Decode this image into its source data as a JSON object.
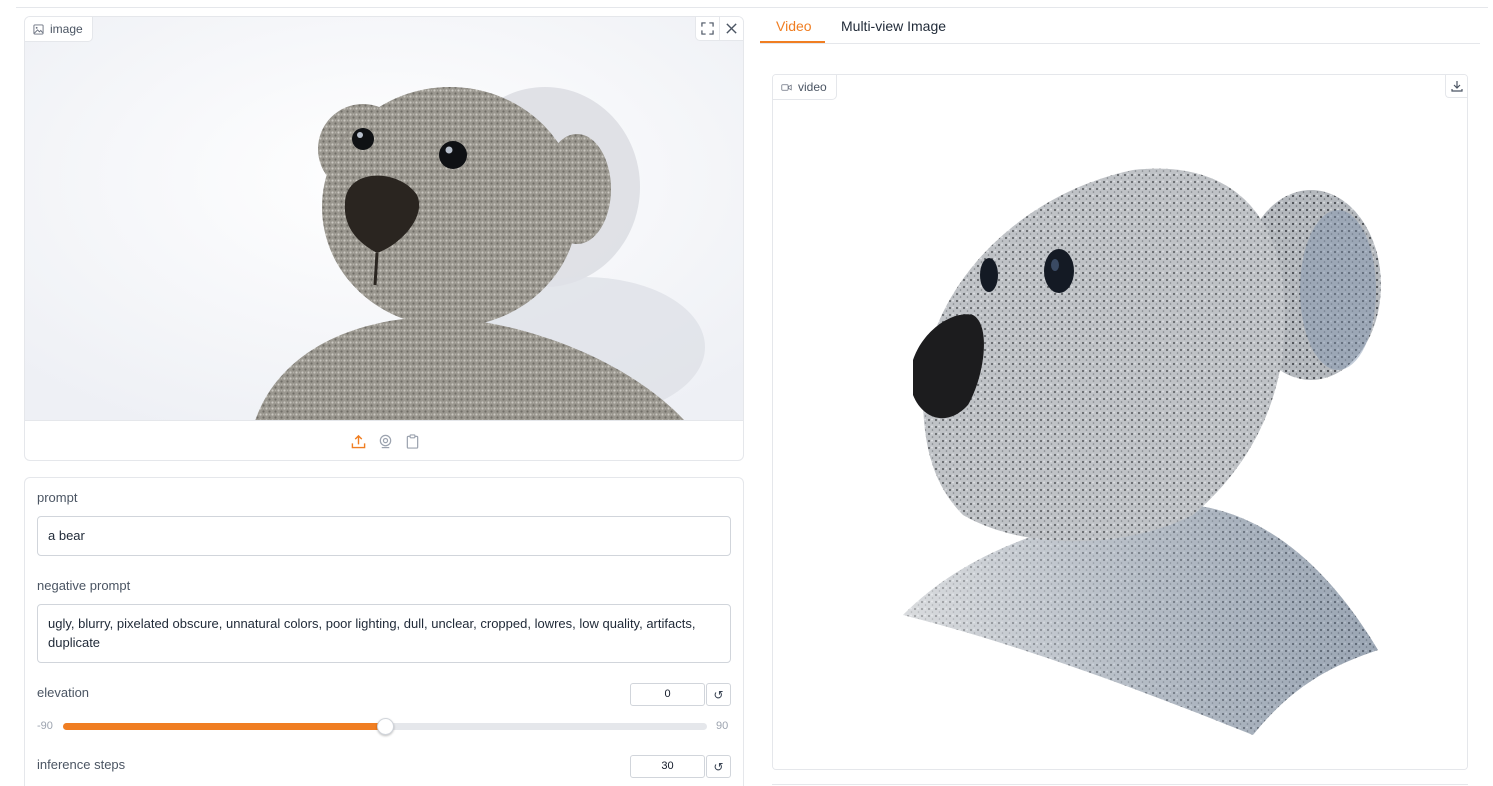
{
  "image_panel": {
    "label": "image",
    "label_icon": "image-icon",
    "fullscreen_icon": "fullscreen-icon",
    "clear_icon": "close-icon",
    "sources": [
      "upload-icon",
      "webcam-icon",
      "clipboard-icon"
    ]
  },
  "form": {
    "prompt_label": "prompt",
    "prompt_value": "a bear",
    "negative_prompt_label": "negative prompt",
    "negative_prompt_value": "ugly, blurry, pixelated obscure, unnatural colors, poor lighting, dull, unclear, cropped, lowres, low quality, artifacts, duplicate",
    "elevation": {
      "label": "elevation",
      "value": "0",
      "min": "-90",
      "max": "90",
      "reset_symbol": "↺"
    },
    "inference_steps": {
      "label": "inference steps",
      "value": "30",
      "reset_symbol": "↺"
    }
  },
  "tabs": [
    {
      "label": "Video",
      "active": true
    },
    {
      "label": "Multi-view Image",
      "active": false
    }
  ],
  "video_panel": {
    "label": "video",
    "label_icon": "video-icon",
    "download_icon": "download-icon"
  },
  "colors": {
    "accent": "#f07e22",
    "border": "#e5e7eb",
    "text_muted": "#4b5563"
  }
}
